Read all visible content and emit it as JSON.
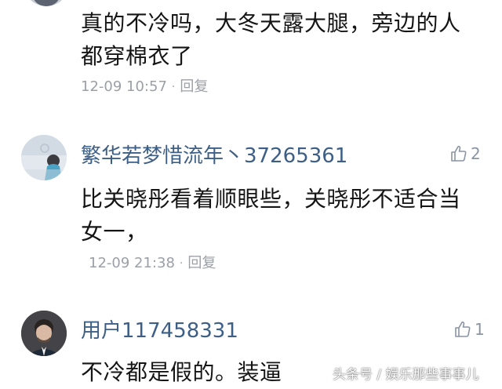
{
  "comments": [
    {
      "text_line1": "真的不冷吗，大冬天露大腿，旁边的人",
      "text_line2": "都穿棉衣了",
      "time": "12-09 10:57",
      "sep": "·",
      "reply": "回复"
    },
    {
      "username": "繁华若梦惜流年丶37265361",
      "likes": "2",
      "text_line1": "比关晓彤看着顺眼些，关晓彤不适合当",
      "text_line2": "女一，",
      "time": "12-09 21:38",
      "sep": "·",
      "reply": "回复"
    },
    {
      "username": "用户117458331",
      "likes": "1",
      "text_line1": "不冷都是假的。装逼"
    }
  ],
  "watermark": "头条号 / 娱乐那些事事儿",
  "colors": {
    "username": "#3d5f86",
    "meta": "#9b9fa6",
    "text": "#151515"
  }
}
